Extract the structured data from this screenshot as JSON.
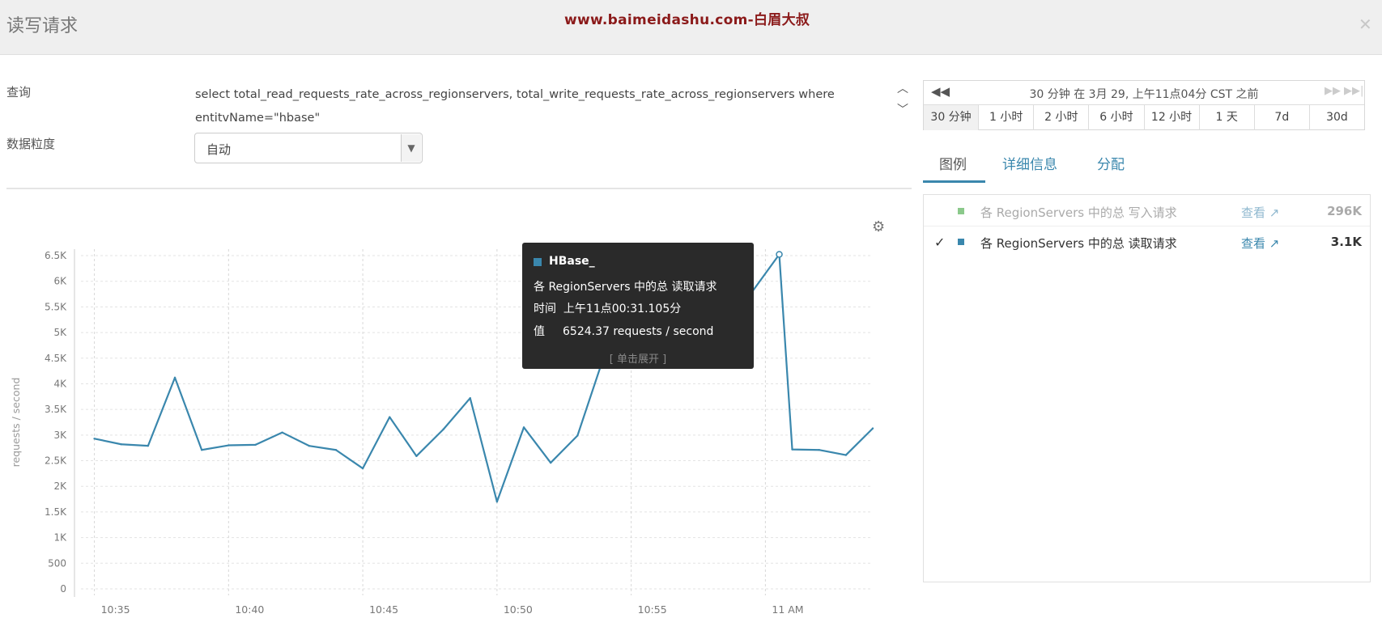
{
  "dialog": {
    "title": "读写请求",
    "watermark": "www.baimeidashu.com-白眉大叔",
    "close_icon": "close-icon"
  },
  "query": {
    "label": "查询",
    "text": "select total_read_requests_rate_across_regionservers, total_write_requests_rate_across_regionservers where entitvName=\"hbase\""
  },
  "granularity": {
    "label": "数据粒度",
    "value": "自动"
  },
  "timenav": {
    "caption": "30 分钟 在 3月 29, 上午11点04分 CST 之前",
    "ranges": [
      "30 分钟",
      "1 小时",
      "2 小时",
      "6 小时",
      "12 小时",
      "1 天",
      "7d",
      "30d"
    ],
    "active_range": "30 分钟"
  },
  "tabs": [
    "图例",
    "详细信息",
    "分配"
  ],
  "active_tab": "图例",
  "legend": [
    {
      "label": "各 RegionServers 中的总 写入请求",
      "link": "查看",
      "value": "296K",
      "color": "#8bc98b",
      "checked": false
    },
    {
      "label": "各 RegionServers 中的总 读取请求",
      "link": "查看",
      "value": "3.1K",
      "color": "#3a87ad",
      "checked": true
    }
  ],
  "tooltip": {
    "host": "HBase_",
    "name": "各 RegionServers 中的总 读取请求",
    "time_label": "时间",
    "time_value": "上午11点00:31.105分",
    "value_label": "值",
    "value_text": "6524.37 requests / second",
    "expand": "[ 单击展开 ]"
  },
  "chart_data": {
    "type": "line",
    "ylabel": "requests / second",
    "ylim": [
      0,
      6500
    ],
    "yticks": [
      0,
      500,
      1000,
      1500,
      2000,
      2500,
      3000,
      3500,
      4000,
      4500,
      5000,
      5500,
      6000,
      6500
    ],
    "ytick_labels": [
      "0",
      "500",
      "1K",
      "1.5K",
      "2K",
      "2.5K",
      "3K",
      "3.5K",
      "4K",
      "4.5K",
      "5K",
      "5.5K",
      "6K",
      "6.5K"
    ],
    "xlim": [
      "10:34:30",
      "11:04:00"
    ],
    "xticks": [
      "10:35",
      "10:40",
      "10:45",
      "10:50",
      "10:55",
      "11:00"
    ],
    "xtick_labels": [
      "10:35",
      "10:40",
      "10:45",
      "10:50",
      "10:55",
      "11 AM"
    ],
    "series": [
      {
        "color": "#3a87ad",
        "x": [
          "10:35:00",
          "10:36:00",
          "10:37:00",
          "10:38:00",
          "10:39:00",
          "10:40:00",
          "10:41:00",
          "10:42:00",
          "10:43:00",
          "10:44:00",
          "10:45:00",
          "10:46:00",
          "10:47:00",
          "10:48:00",
          "10:49:00",
          "10:50:00",
          "10:51:00",
          "10:52:00",
          "10:53:00",
          "10:54:00",
          "10:55:00",
          "10:56:00",
          "10:57:00",
          "10:58:00",
          "10:59:00",
          "11:00:31",
          "11:01:00",
          "11:02:00",
          "11:03:00",
          "11:04:00"
        ],
        "values": [
          2930,
          2820,
          2790,
          4120,
          2710,
          2800,
          2810,
          3050,
          2790,
          2710,
          2350,
          3350,
          2590,
          3110,
          3720,
          1700,
          3150,
          2460,
          2990,
          4560,
          5120,
          5600,
          5000,
          5900,
          5430,
          6524,
          2720,
          2710,
          2610,
          3130
        ]
      }
    ],
    "grid": true
  }
}
